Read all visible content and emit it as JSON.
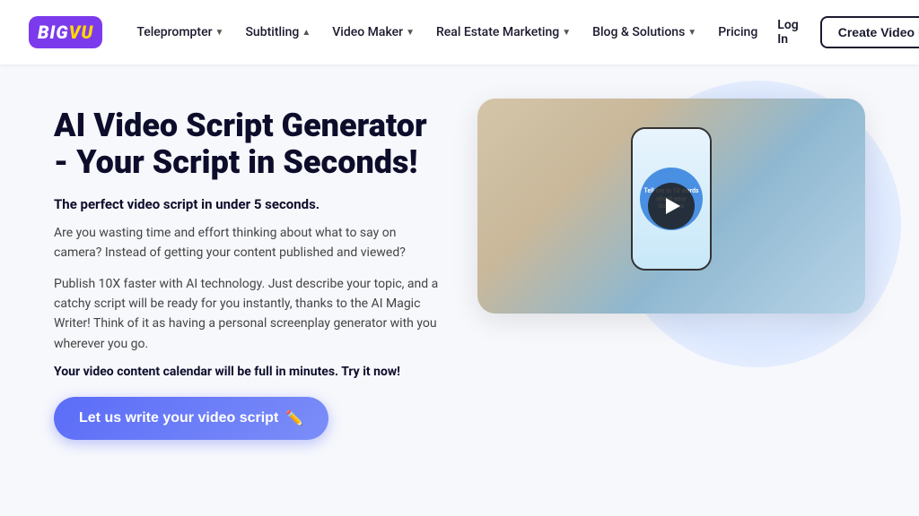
{
  "logo": {
    "text_big": "BIG",
    "text_vu": "VU"
  },
  "nav": {
    "items": [
      {
        "label": "Teleprompter",
        "has_arrow": true,
        "arrow_up": false
      },
      {
        "label": "Subtitling",
        "has_arrow": true,
        "arrow_up": true
      },
      {
        "label": "Video Maker",
        "has_arrow": true,
        "arrow_up": false
      },
      {
        "label": "Real Estate Marketing",
        "has_arrow": true,
        "arrow_up": false
      },
      {
        "label": "Blog & Solutions",
        "has_arrow": true,
        "arrow_up": false
      },
      {
        "label": "Pricing",
        "has_arrow": false,
        "arrow_up": false
      }
    ],
    "login_label": "Log In",
    "create_label": "Create Video Free"
  },
  "hero": {
    "title": "AI Video Script Generator - Your Script in Seconds!",
    "subtitle": "The perfect video script in under 5 seconds.",
    "body1": "Are you wasting time and effort thinking about what to say on camera? Instead of getting your content published and viewed?",
    "body2": "Publish 10X faster with AI technology. Just describe your topic, and a catchy script will be ready for you instantly, thanks to the AI Magic Writer! Think of it as having a personal screenplay generator with you wherever you go.",
    "cta_text": "Your video content calendar will be full in minutes. Try it now!",
    "button_label": "Let us write your video script",
    "button_emoji": "✏️"
  }
}
